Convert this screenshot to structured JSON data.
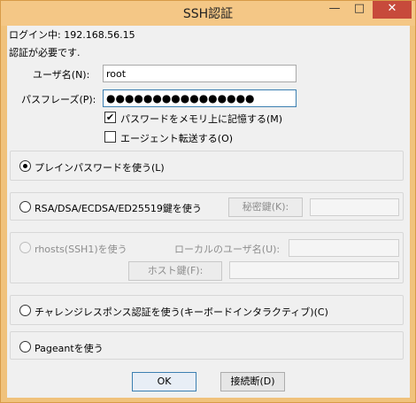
{
  "window": {
    "title": "SSH認証",
    "minimize_glyph": "—",
    "maximize_glyph": "□",
    "close_glyph": "✕"
  },
  "status": {
    "login_line": "ログイン中: 192.168.56.15",
    "auth_required": "認証が必要です."
  },
  "form": {
    "username_label": "ユーザ名(N):",
    "username_value": "root",
    "passphrase_label": "パスフレーズ(P):",
    "passphrase_mask": "●●●●●●●●●●●●●●●●",
    "remember_label": "パスワードをメモリ上に記憶する(M)",
    "remember_checked": true,
    "remember_glyph": "✔",
    "agent_forward_label": "エージェント転送する(O)",
    "agent_forward_checked": false
  },
  "methods": {
    "plain_password_label": "プレインパスワードを使う(L)",
    "rsa_label": "RSA/DSA/ECDSA/ED25519鍵を使う",
    "private_key_button": "秘密鍵(K):",
    "rhosts_label": "rhosts(SSH1)を使う",
    "local_user_label": "ローカルのユーザ名(U):",
    "host_key_button": "ホスト鍵(F):",
    "challenge_label": "チャレンジレスポンス認証を使う(キーボードインタラクティブ)(C)",
    "pageant_label": "Pageantを使う",
    "selected": "plain_password"
  },
  "buttons": {
    "ok": "OK",
    "disconnect": "接続断(D)"
  },
  "colors": {
    "titlebar": "#f4c786",
    "close": "#c74a3b",
    "dialog_bg": "#f0f0f0",
    "focus_border": "#3c7fb1"
  }
}
